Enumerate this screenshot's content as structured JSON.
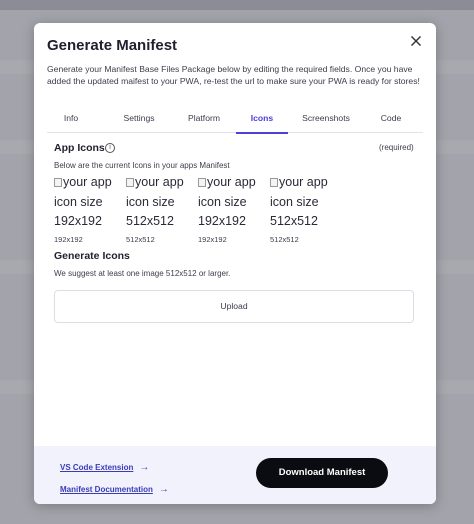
{
  "modal": {
    "title": "Generate Manifest",
    "close_icon": "close-icon",
    "description": "Generate your Manifest Base Files Package below by editing the required fields. Once you have added the updated maifest to your PWA, re-test the url to make sure your PWA is ready for stores!"
  },
  "tabs": [
    {
      "label": "Info"
    },
    {
      "label": "Settings"
    },
    {
      "label": "Platform"
    },
    {
      "label": "Icons",
      "active": true
    },
    {
      "label": "Screenshots"
    },
    {
      "label": "Code"
    }
  ],
  "app_icons": {
    "title": "App Icons",
    "info_icon": "info-icon",
    "required_label": "(required)",
    "subtitle": "Below are the current Icons in your apps Manifest",
    "icons": [
      {
        "alt": "your app icon size 192x192",
        "size": "192x192"
      },
      {
        "alt": "your app icon size 512x512",
        "size": "512x512"
      },
      {
        "alt": "your app icon size 192x192",
        "size": "192x192"
      },
      {
        "alt": "your app icon size 512x512",
        "size": "512x512"
      }
    ]
  },
  "generate_icons": {
    "title": "Generate Icons",
    "subtitle": "We suggest at least one image 512x512 or larger.",
    "upload_label": "Upload"
  },
  "footer": {
    "vscode_link": "VS Code Extension",
    "docs_link": "Manifest Documentation",
    "arrow_icon": "arrow-right-icon",
    "download_label": "Download Manifest"
  },
  "colors": {
    "accent": "#4f3fd6",
    "link": "#3b3bb8",
    "button_bg": "#0b0b12",
    "footer_bg": "#f1f2fb"
  }
}
